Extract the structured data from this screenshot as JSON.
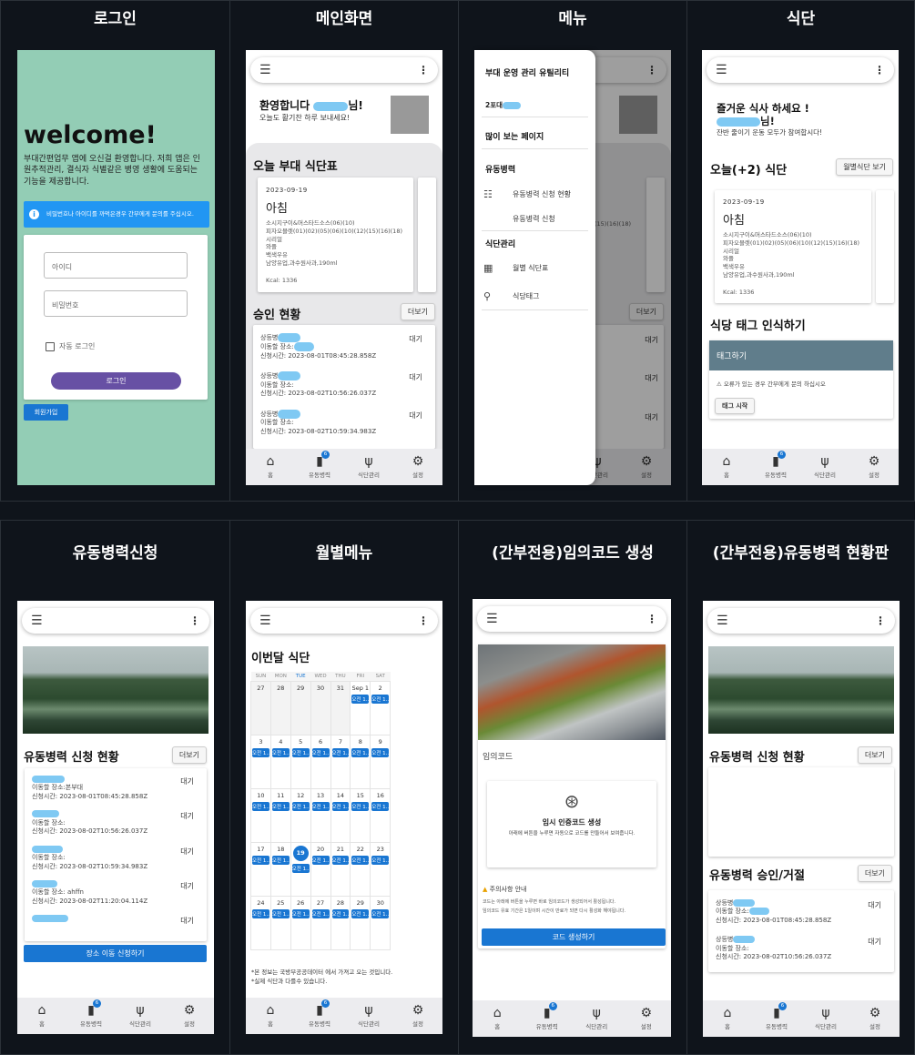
{
  "headers": [
    "로그인",
    "메인화면",
    "메뉴",
    "식단",
    "유동병력신청",
    "월별메뉴",
    "(간부전용)임의코드 생성",
    "(간부전용)유동병력 현황판"
  ],
  "nav": [
    {
      "icon": "home-icon",
      "label": "홈"
    },
    {
      "icon": "people-icon",
      "label": "유동병력",
      "badge": "6"
    },
    {
      "icon": "fork-knife-icon",
      "label": "식단관리"
    },
    {
      "icon": "gear-icon",
      "label": "설정"
    }
  ],
  "login": {
    "welcome": "welcome!",
    "desc": "부대간편업무 앱에 오신걸 환영합니다. 저희 앱은 인원추적관리, 결식자 식별같은 병영 생활에 도움되는 기능을 제공합니다.",
    "info": "비밀번호나 아이디를 까먹은경우 간부에게 문의를 주십시오.",
    "id_placeholder": "아이디",
    "pw_placeholder": "비밀번호",
    "auto_login": "자동 로그인",
    "login_btn": "로그인",
    "signup_btn": "회원가입",
    "colors": {
      "bg": "#93cdb5",
      "accent": "#6750a4",
      "info": "#2196f3"
    }
  },
  "main": {
    "welcome": "환영합니다",
    "welcome_tail": "님!",
    "sub": "오늘도 활기찬 하루 보내세요!",
    "menu_title": "오늘 부대 식단표",
    "meal": {
      "date": "2023-09-19",
      "name": "아침",
      "items": [
        "소시지구이&머스타드소스(06)(10)",
        "피자오믈렛(01)(02)(05)(06)(10)(12)(15)(16)(18)",
        "시리얼",
        "와플",
        "백색우유",
        "남양유업,과수원사과,190ml"
      ],
      "kcal": "Kcal: 1336"
    },
    "approval_title": "승인 현황",
    "more": "더보기",
    "requests": [
      {
        "name": "상등병",
        "place": "이동할 장소:",
        "time": "신청시간: 2023-08-01T08:45:28.858Z",
        "status": "대기"
      },
      {
        "name": "상등병",
        "place": "이동할 장소:",
        "time": "신청시간: 2023-08-02T10:56:26.037Z",
        "status": "대기"
      },
      {
        "name": "상등병",
        "place": "이동할 장소:",
        "time": "신청시간: 2023-08-02T10:59:34.983Z",
        "status": "대기"
      }
    ]
  },
  "menu": {
    "title": "부대 운영 관리 유틸리티",
    "user": "2포대",
    "frequent": "많이 보는 페이지",
    "group1": "유동병력",
    "g1_items": [
      "유동병력 신청 현황",
      "유동병력 신청"
    ],
    "group2": "식단관리",
    "g2_items": [
      "월별 식단표",
      "식당태그"
    ]
  },
  "diet": {
    "greet": "즐거운 식사 하세요 !",
    "greet_tail": "님!",
    "sub": "잔반 줄이기 운동 모두가 참여합시다!",
    "today_title": "오늘(+2) 식단",
    "monthly_btn": "월별식단 보기",
    "tag_title": "식당 태그 인식하기",
    "tag_card": "태그하기",
    "tag_warn": "⚠ 오류가 있는 경우 간부에게 문의 하십시오",
    "tag_start": "태그 시작"
  },
  "apply": {
    "title": "유동병력 신청 현황",
    "more": "더보기",
    "requests": [
      {
        "place": "이동할 장소:본부대",
        "time": "신청시간: 2023-08-01T08:45:28.858Z",
        "status": "대기"
      },
      {
        "place": "이동할 장소:",
        "time": "신청시간: 2023-08-02T10:56:26.037Z",
        "status": "대기"
      },
      {
        "place": "이동할 장소:",
        "time": "신청시간: 2023-08-02T10:59:34.983Z",
        "status": "대기"
      },
      {
        "place": "이동할 장소: ahffn",
        "time": "신청시간: 2023-08-02T11:20:04.114Z",
        "status": "대기"
      },
      {
        "place": "",
        "time": "",
        "status": "대기"
      }
    ],
    "apply_btn": "장소 이동 신청하기"
  },
  "monthly": {
    "title": "이번달 식단",
    "days": [
      "SUN",
      "MON",
      "TUE",
      "WED",
      "THU",
      "FRI",
      "SAT"
    ],
    "weeks": [
      [
        "27",
        "28",
        "29",
        "30",
        "31",
        "Sep 1",
        "2"
      ],
      [
        "3",
        "4",
        "5",
        "6",
        "7",
        "8",
        "9"
      ],
      [
        "10",
        "11",
        "12",
        "13",
        "14",
        "15",
        "16"
      ],
      [
        "17",
        "18",
        "19",
        "20",
        "21",
        "22",
        "23"
      ],
      [
        "24",
        "25",
        "26",
        "27",
        "28",
        "29",
        "30"
      ]
    ],
    "event": "오전 1..",
    "today": "19",
    "note1": "*본 정보는 국방부공공데이터 에서 가져고 오는 것입니다.",
    "note2": "*실제 식단과 다를수 있습니다."
  },
  "code": {
    "label": "임의코드",
    "gen_title": "임시 인증코드 생성",
    "gen_desc": "아래에 버튼을 누루면 자동으로 코드를 만들어서 보여줍니다.",
    "notice_title": "주의사항 안내",
    "notice1": "코드는 아래에 버튼을 누루면 바로 임의코드가 생성되어서 활성됩니다.",
    "notice2": "임의코드 유효 기간은 1일이며 시간이 만료가 되면 다시 활성화 해야됩니다.",
    "btn": "코드 생성하기"
  },
  "board": {
    "title": "유동병력 신청 현황",
    "more": "더보기",
    "approve_title": "유동병력 승인/거절",
    "requests": [
      {
        "name": "상등병",
        "place": "이동할 장소:",
        "time": "신청시간: 2023-08-01T08:45:28.858Z",
        "status": "대기"
      },
      {
        "name": "상등병",
        "place": "이동할 장소:",
        "time": "신청시간: 2023-08-02T10:56:26.037Z",
        "status": "대기"
      }
    ]
  }
}
